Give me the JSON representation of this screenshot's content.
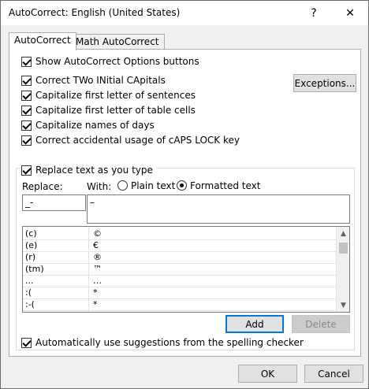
{
  "window": {
    "title": "AutoCorrect: English (United States)",
    "help_glyph": "?",
    "close_glyph": "✕"
  },
  "tabs": [
    {
      "label": "AutoCorrect",
      "active": true
    },
    {
      "label": "Math AutoCorrect",
      "active": false
    }
  ],
  "options": {
    "show_buttons": "Show AutoCorrect Options buttons",
    "two_initial": "Correct TWo INitial CApitals",
    "first_letter_sentences": "Capitalize first letter of sentences",
    "first_letter_cells": "Capitalize first letter of table cells",
    "names_of_days": "Capitalize names of days",
    "caps_lock": "Correct accidental usage of cAPS LOCK key",
    "exceptions_button": "Exceptions...",
    "replace_as_you_type": "Replace text as you type"
  },
  "replace": {
    "replace_label": "Replace:",
    "with_label": "With:",
    "plain_text": "Plain text",
    "formatted_text": "Formatted text",
    "replace_value": "_-",
    "with_value": "–"
  },
  "entries": [
    {
      "from": "(c)",
      "to": "©"
    },
    {
      "from": "(e)",
      "to": "€"
    },
    {
      "from": "(r)",
      "to": "®"
    },
    {
      "from": "(tm)",
      "to": "™"
    },
    {
      "from": "...",
      "to": "…"
    },
    {
      "from": ":(",
      "to": "*"
    },
    {
      "from": ":-(",
      "to": "*"
    }
  ],
  "buttons": {
    "add": "Add",
    "delete": "Delete",
    "ok": "OK",
    "cancel": "Cancel"
  },
  "suggestions": "Automatically use suggestions from the spelling checker"
}
